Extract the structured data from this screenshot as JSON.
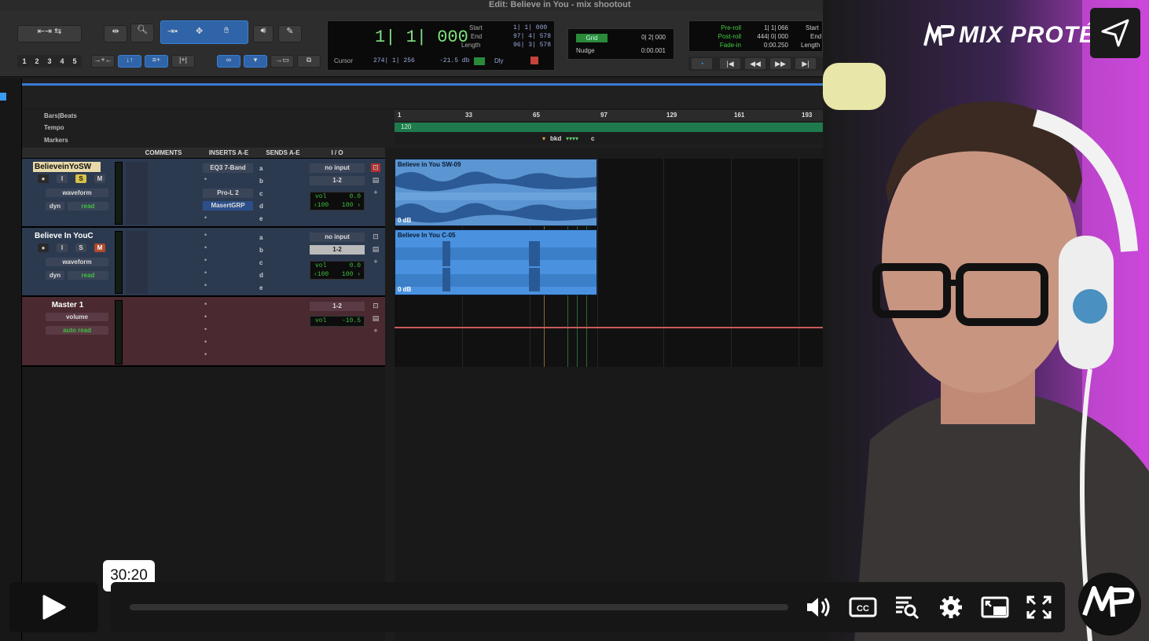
{
  "window": {
    "title": "Edit: Believe in You - mix shootout"
  },
  "toolbar": {
    "zoom_presets": [
      "1",
      "2",
      "3",
      "4",
      "5"
    ]
  },
  "counter": {
    "main": "1| 1| 000",
    "start_label": "Start",
    "end_label": "End",
    "length_label": "Length",
    "start": "1| 1| 000",
    "end": "97| 4| 578",
    "length": "96| 3| 578",
    "cursor_label": "Cursor",
    "cursor": "274| 1| 256",
    "cursor_db": "-21.5 db",
    "dly_label": "Dly"
  },
  "grid": {
    "grid_label": "Grid",
    "grid_value": "0| 2| 000",
    "nudge_label": "Nudge",
    "nudge_value": "0:00.001"
  },
  "preroll": {
    "preroll_label": "Pre-roll",
    "postroll_label": "Post-roll",
    "fadein_label": "Fade-in",
    "preroll": "1| 1| 066",
    "postroll": "444| 0| 000",
    "fadein": "0:00.250",
    "start_label": "Start",
    "end_label": "End",
    "length_label": "Length"
  },
  "rulers": {
    "bars_beats": "Bars|Beats",
    "tempo": "Tempo",
    "markers": "Markers",
    "bar_ticks": [
      "1",
      "33",
      "65",
      "97",
      "129",
      "161",
      "193"
    ],
    "tempo_value": "120",
    "marker_text": "bkd",
    "marker_text2": "c"
  },
  "columns": {
    "comments": "COMMENTS",
    "inserts": "INSERTS A-E",
    "sends": "SENDS A-E",
    "io": "I / O"
  },
  "tracks": [
    {
      "name": "BelieveinYoSW",
      "buttons": [
        "I",
        "S",
        "M"
      ],
      "view": "waveform",
      "auto_label": "dyn",
      "auto_mode": "read",
      "inserts": [
        "EQ3 7-Band",
        "Pro-L 2",
        "MasertGRP"
      ],
      "sends": [
        "a",
        "b",
        "c",
        "d",
        "e"
      ],
      "input": "no input",
      "output": "1-2",
      "vol_label": "vol",
      "vol": "0.0",
      "pan_l": "‹100",
      "pan_r": "100 ›",
      "clip_name": "Believe in You SW-09",
      "clip_db": "0 dB"
    },
    {
      "name": "Believe In YouC",
      "buttons": [
        "I",
        "S",
        "M"
      ],
      "view": "waveform",
      "auto_label": "dyn",
      "auto_mode": "read",
      "sends": [
        "a",
        "b",
        "c",
        "d",
        "e"
      ],
      "input": "no input",
      "output": "1-2",
      "vol_label": "vol",
      "vol": "0.0",
      "pan_l": "‹100",
      "pan_r": "100 ›",
      "clip_name": "Believe In You C-05",
      "clip_db": "0 dB"
    },
    {
      "name": "Master 1",
      "view": "volume",
      "auto_mode": "auto read",
      "output": "1-2",
      "vol_label": "vol",
      "vol": "-10.5"
    }
  ],
  "brand": {
    "name": "MIX PROTÉGÉ"
  },
  "player": {
    "tooltip_time": "30:20",
    "progress": 0.0
  },
  "colors": {
    "clip_blue": "#4a8ed8",
    "tempo_green": "#1f7a4d",
    "selected_blue": "#2f64a8",
    "master_track": "#4a2a30"
  }
}
